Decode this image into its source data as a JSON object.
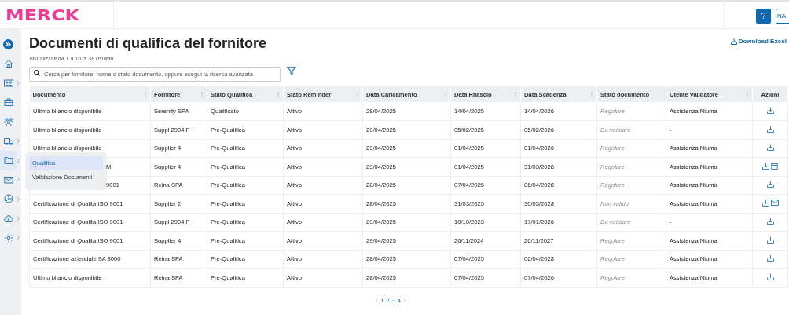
{
  "header": {
    "logo": "MERCK",
    "help_button": "?",
    "user_button": "NA"
  },
  "sidebar": {
    "items": [
      {
        "kind": "home",
        "expandable": false,
        "selected": false
      },
      {
        "kind": "id-card",
        "expandable": true,
        "selected": false
      },
      {
        "kind": "briefcase",
        "expandable": false,
        "selected": false
      },
      {
        "kind": "people",
        "expandable": false,
        "selected": false
      },
      {
        "kind": "truck",
        "expandable": true,
        "selected": false
      },
      {
        "kind": "folder",
        "expandable": true,
        "selected": true
      },
      {
        "kind": "mail",
        "expandable": true,
        "selected": false
      },
      {
        "kind": "chart",
        "expandable": true,
        "selected": false
      },
      {
        "kind": "cloud",
        "expandable": true,
        "selected": false
      },
      {
        "kind": "gear",
        "expandable": true,
        "selected": false
      }
    ]
  },
  "submenu": {
    "items": [
      {
        "label": "Qualifica",
        "selected": true
      },
      {
        "label": "Validazione Documenti",
        "selected": false
      }
    ]
  },
  "page": {
    "title": "Documenti di qualifica del fornitore",
    "subtitle": "Visualizzati da 1 a 10 di 38 risultati",
    "download": "Download Excel"
  },
  "search": {
    "placeholder": "Cerca per fornitore, nome o stato documento, oppure esegui la ricerca avanzata"
  },
  "table": {
    "columns": [
      {
        "label": "Documento",
        "sortable": true
      },
      {
        "label": "Fornitore",
        "sortable": true
      },
      {
        "label": "Stato Qualifica",
        "sortable": true
      },
      {
        "label": "Stato Reminder",
        "sortable": true
      },
      {
        "label": "Data Caricamento",
        "sortable": true
      },
      {
        "label": "Data Rilascio",
        "sortable": true
      },
      {
        "label": "Data Scadenza",
        "sortable": true
      },
      {
        "label": "Stato documento",
        "sortable": false
      },
      {
        "label": "Utente Validatore",
        "sortable": true
      },
      {
        "label": "Azioni",
        "sortable": false
      }
    ],
    "rows": [
      {
        "documento": "Ultimo bilancio disponibile",
        "covered": false,
        "fornitore": "Serenity SPA",
        "stato_qualifica": "Qualificato",
        "stato_reminder": "Attivo",
        "data_caricamento": "28/04/2025",
        "data_rilascio": "14/04/2025",
        "data_scadenza": "14/04/2026",
        "stato_documento": "Regolare",
        "utente": "Assistenza Niuma",
        "actions": [
          {
            "kind": "download"
          }
        ]
      },
      {
        "documento": "Ultimo bilancio disponibile",
        "covered": false,
        "fornitore": "Suppl 2904 F",
        "stato_qualifica": "Pre-Qualifica",
        "stato_reminder": "Attivo",
        "data_caricamento": "29/04/2025",
        "data_rilascio": "05/02/2025",
        "data_scadenza": "05/02/2026",
        "stato_documento": "Da validare",
        "utente": "-",
        "actions": [
          {
            "kind": "download"
          }
        ]
      },
      {
        "documento": "Ultimo bilancio disponibile",
        "covered": false,
        "fornitore": "Supplier 4",
        "stato_qualifica": "Pre-Qualifica",
        "stato_reminder": "Attivo",
        "data_caricamento": "29/04/2025",
        "data_rilascio": "01/04/2025",
        "data_scadenza": "01/04/2026",
        "stato_documento": "Regolare",
        "utente": "Assistenza Niuma",
        "actions": [
          {
            "kind": "download"
          }
        ]
      },
      {
        "documento": "M",
        "covered": true,
        "fornitore": "Supplier 4",
        "stato_qualifica": "Pre-Qualifica",
        "stato_reminder": "Attivo",
        "data_caricamento": "29/04/2025",
        "data_rilascio": "01/04/2025",
        "data_scadenza": "31/03/2028",
        "stato_documento": "Regolare",
        "utente": "Assistenza Niuma",
        "actions": [
          {
            "kind": "download"
          },
          {
            "kind": "calendar"
          }
        ]
      },
      {
        "documento": "9001",
        "covered": true,
        "fornitore": "Reina SPA",
        "stato_qualifica": "Pre-Qualifica",
        "stato_reminder": "Attivo",
        "data_caricamento": "28/04/2025",
        "data_rilascio": "07/04/2025",
        "data_scadenza": "06/04/2028",
        "stato_documento": "Regolare",
        "utente": "Assistenza Niuma",
        "actions": [
          {
            "kind": "download"
          }
        ]
      },
      {
        "documento": "Certificazione di Qualità ISO 9001",
        "covered": false,
        "fornitore": "Supplier 2",
        "stato_qualifica": "Pre-Qualifica",
        "stato_reminder": "Attivo",
        "data_caricamento": "28/04/2025",
        "data_rilascio": "31/03/2025",
        "data_scadenza": "30/03/2028",
        "stato_documento": "Non valido",
        "utente": "Assistenza Niuma",
        "actions": [
          {
            "kind": "download"
          },
          {
            "kind": "mail"
          }
        ]
      },
      {
        "documento": "Certificazione di Qualità ISO 9001",
        "covered": false,
        "fornitore": "Suppl 2904 F",
        "stato_qualifica": "Pre-Qualifica",
        "stato_reminder": "Attivo",
        "data_caricamento": "29/04/2025",
        "data_rilascio": "10/10/2023",
        "data_scadenza": "17/01/2026",
        "stato_documento": "Da validare",
        "utente": "-",
        "actions": [
          {
            "kind": "download"
          }
        ]
      },
      {
        "documento": "Certificazione di Qualità ISO 9001",
        "covered": false,
        "fornitore": "Supplier 4",
        "stato_qualifica": "Pre-Qualifica",
        "stato_reminder": "Attivo",
        "data_caricamento": "29/04/2025",
        "data_rilascio": "26/11/2024",
        "data_scadenza": "26/11/2027",
        "stato_documento": "Regolare",
        "utente": "Assistenza Niuma",
        "actions": [
          {
            "kind": "download"
          }
        ]
      },
      {
        "documento": "Certificazione aziendale SA 8000",
        "covered": false,
        "fornitore": "Reina SPA",
        "stato_qualifica": "Pre-Qualifica",
        "stato_reminder": "Attivo",
        "data_caricamento": "28/04/2025",
        "data_rilascio": "07/04/2025",
        "data_scadenza": "06/04/2028",
        "stato_documento": "Regolare",
        "utente": "Assistenza Niuma",
        "actions": [
          {
            "kind": "download"
          }
        ]
      },
      {
        "documento": "Ultimo bilancio disponibile",
        "covered": false,
        "fornitore": "Reina SPA",
        "stato_qualifica": "Pre-Qualifica",
        "stato_reminder": "Attivo",
        "data_caricamento": "28/04/2025",
        "data_rilascio": "07/04/2025",
        "data_scadenza": "07/04/2026",
        "stato_documento": "Regolare",
        "utente": "Assistenza Niuma",
        "actions": [
          {
            "kind": "download"
          }
        ]
      }
    ]
  },
  "pagination": {
    "pages": [
      {
        "label": "1",
        "selected": true
      },
      {
        "label": "2",
        "selected": false
      },
      {
        "label": "3",
        "selected": false
      },
      {
        "label": "4",
        "selected": false
      }
    ]
  }
}
